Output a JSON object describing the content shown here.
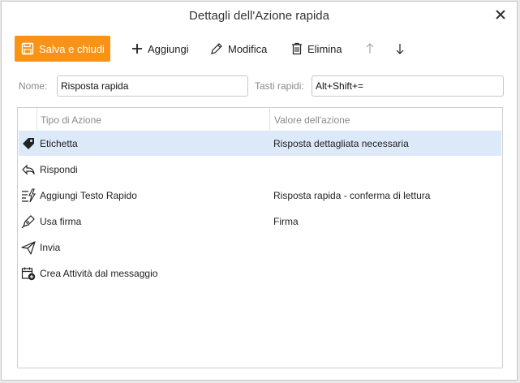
{
  "dialog": {
    "title": "Dettagli dell'Azione rapida",
    "close_icon": "close-icon"
  },
  "toolbar": {
    "save_label": "Salva e chiudi",
    "add_label": "Aggiungi",
    "edit_label": "Modifica",
    "delete_label": "Elimina"
  },
  "form": {
    "name_label": "Nome:",
    "name_value": "Risposta rapida",
    "shortcut_label": "Tasti rapidi:",
    "shortcut_value": "Alt+Shift+="
  },
  "table": {
    "columns": [
      "Tipo di Azione",
      "Valore dell'azione"
    ],
    "rows": [
      {
        "icon": "tag-icon",
        "type": "Etichetta",
        "value": "Risposta dettagliata necessaria",
        "selected": true
      },
      {
        "icon": "reply-icon",
        "type": "Rispondi",
        "value": ""
      },
      {
        "icon": "quick-text-icon",
        "type": "Aggiungi Testo Rapido",
        "value": "Risposta rapida - conferma di lettura"
      },
      {
        "icon": "signature-pen-icon",
        "type": "Usa firma",
        "value": "Firma"
      },
      {
        "icon": "send-icon",
        "type": "Invia",
        "value": ""
      },
      {
        "icon": "calendar-add-icon",
        "type": "Crea Attività dal messaggio",
        "value": ""
      }
    ]
  },
  "colors": {
    "accent": "#f79418",
    "selected_row": "#dce9f9"
  }
}
